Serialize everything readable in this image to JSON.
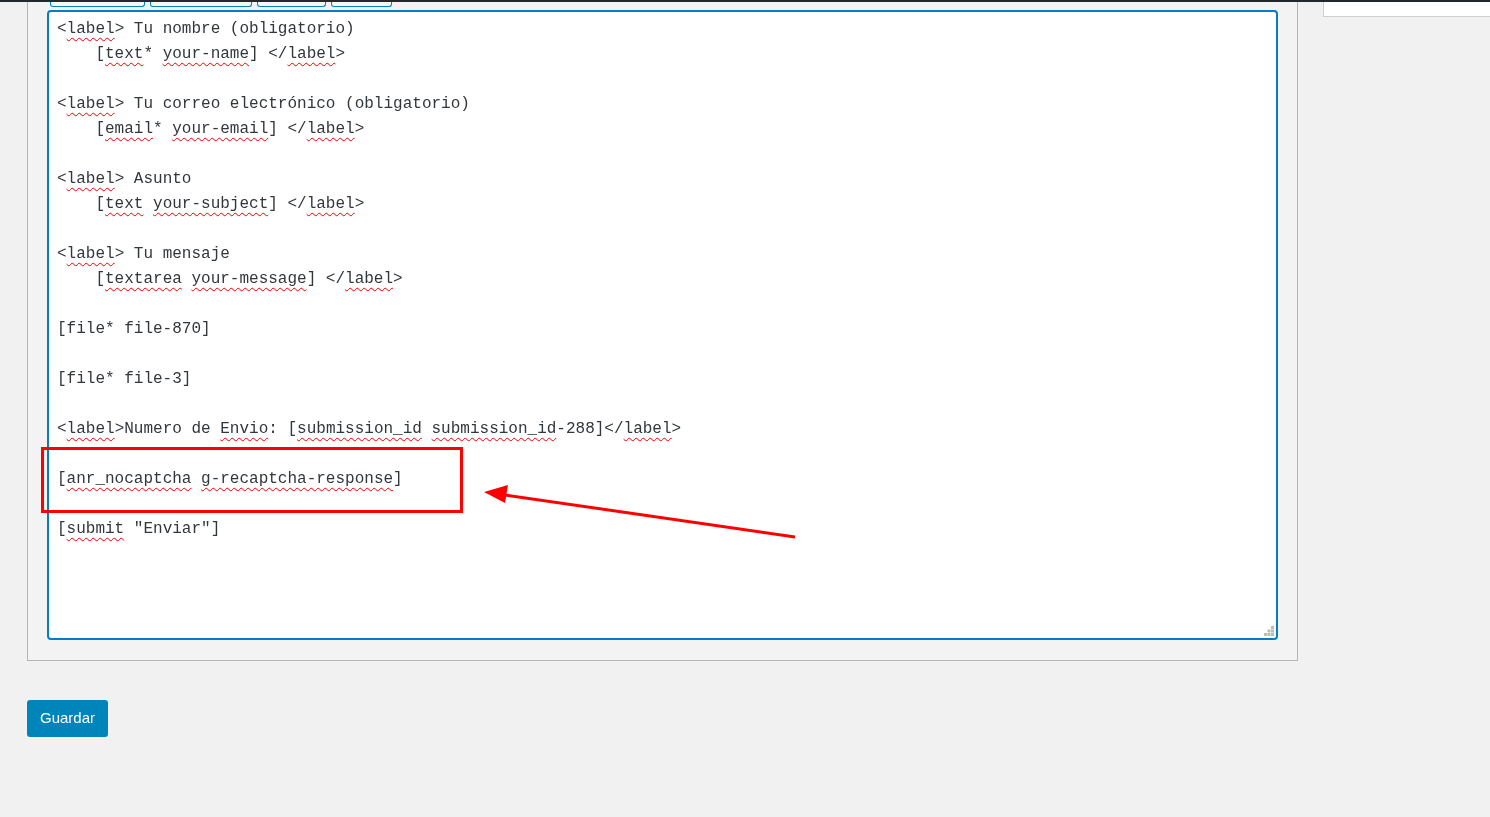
{
  "editor": {
    "blocks": [
      {
        "highlighted": false,
        "lines": [
          [
            {
              "text": "<",
              "misspelled": false
            },
            {
              "text": "label",
              "misspelled": true
            },
            {
              "text": "> Tu nombre (obligatorio)",
              "misspelled": false
            }
          ],
          [
            {
              "text": "    [",
              "misspelled": false
            },
            {
              "text": "text",
              "misspelled": true
            },
            {
              "text": "* ",
              "misspelled": false
            },
            {
              "text": "your-name",
              "misspelled": true
            },
            {
              "text": "] </",
              "misspelled": false
            },
            {
              "text": "label",
              "misspelled": true
            },
            {
              "text": ">",
              "misspelled": false
            }
          ]
        ]
      },
      {
        "highlighted": false,
        "lines": [
          [
            {
              "text": "<",
              "misspelled": false
            },
            {
              "text": "label",
              "misspelled": true
            },
            {
              "text": "> Tu correo electrónico (obligatorio)",
              "misspelled": false
            }
          ],
          [
            {
              "text": "    [",
              "misspelled": false
            },
            {
              "text": "email",
              "misspelled": true
            },
            {
              "text": "* ",
              "misspelled": false
            },
            {
              "text": "your-email",
              "misspelled": true
            },
            {
              "text": "] </",
              "misspelled": false
            },
            {
              "text": "label",
              "misspelled": true
            },
            {
              "text": ">",
              "misspelled": false
            }
          ]
        ]
      },
      {
        "highlighted": false,
        "lines": [
          [
            {
              "text": "<",
              "misspelled": false
            },
            {
              "text": "label",
              "misspelled": true
            },
            {
              "text": "> Asunto",
              "misspelled": false
            }
          ],
          [
            {
              "text": "    [",
              "misspelled": false
            },
            {
              "text": "text",
              "misspelled": true
            },
            {
              "text": "your-subject",
              "misspelled": true,
              "space_before": true
            },
            {
              "text": "] </",
              "misspelled": false
            },
            {
              "text": "label",
              "misspelled": true
            },
            {
              "text": ">",
              "misspelled": false
            }
          ]
        ]
      },
      {
        "highlighted": false,
        "lines": [
          [
            {
              "text": "<",
              "misspelled": false
            },
            {
              "text": "label",
              "misspelled": true
            },
            {
              "text": "> Tu mensaje",
              "misspelled": false
            }
          ],
          [
            {
              "text": "    [",
              "misspelled": false
            },
            {
              "text": "textarea",
              "misspelled": true
            },
            {
              "text": "your-message",
              "misspelled": true,
              "space_before": true
            },
            {
              "text": "] </",
              "misspelled": false
            },
            {
              "text": "label",
              "misspelled": true
            },
            {
              "text": ">",
              "misspelled": false
            }
          ]
        ]
      },
      {
        "highlighted": false,
        "lines": [
          [
            {
              "text": "[file* file-870]",
              "misspelled": false
            }
          ]
        ]
      },
      {
        "highlighted": false,
        "lines": [
          [
            {
              "text": "[file* file-3]",
              "misspelled": false
            }
          ]
        ]
      },
      {
        "highlighted": false,
        "lines": [
          [
            {
              "text": "<",
              "misspelled": false
            },
            {
              "text": "label",
              "misspelled": true
            },
            {
              "text": ">Numero de ",
              "misspelled": false
            },
            {
              "text": "Envio",
              "misspelled": true
            },
            {
              "text": ": [",
              "misspelled": false
            },
            {
              "text": "submission_id",
              "misspelled": true
            },
            {
              "text": "submission_id",
              "misspelled": true,
              "space_before": true
            },
            {
              "text": "-288]</",
              "misspelled": false
            },
            {
              "text": "label",
              "misspelled": true
            },
            {
              "text": ">",
              "misspelled": false
            }
          ]
        ]
      },
      {
        "highlighted": true,
        "lines": [
          [
            {
              "text": "[",
              "misspelled": false
            },
            {
              "text": "anr_nocaptcha",
              "misspelled": true
            },
            {
              "text": "g-recaptcha-response",
              "misspelled": true,
              "space_before": true
            },
            {
              "text": "]",
              "misspelled": false
            }
          ]
        ]
      },
      {
        "highlighted": false,
        "lines": [
          [
            {
              "text": "[",
              "misspelled": false
            },
            {
              "text": "submit",
              "misspelled": true
            },
            {
              "text": " \"Enviar\"]",
              "misspelled": false
            }
          ]
        ]
      }
    ]
  },
  "save_button": "Guardar"
}
